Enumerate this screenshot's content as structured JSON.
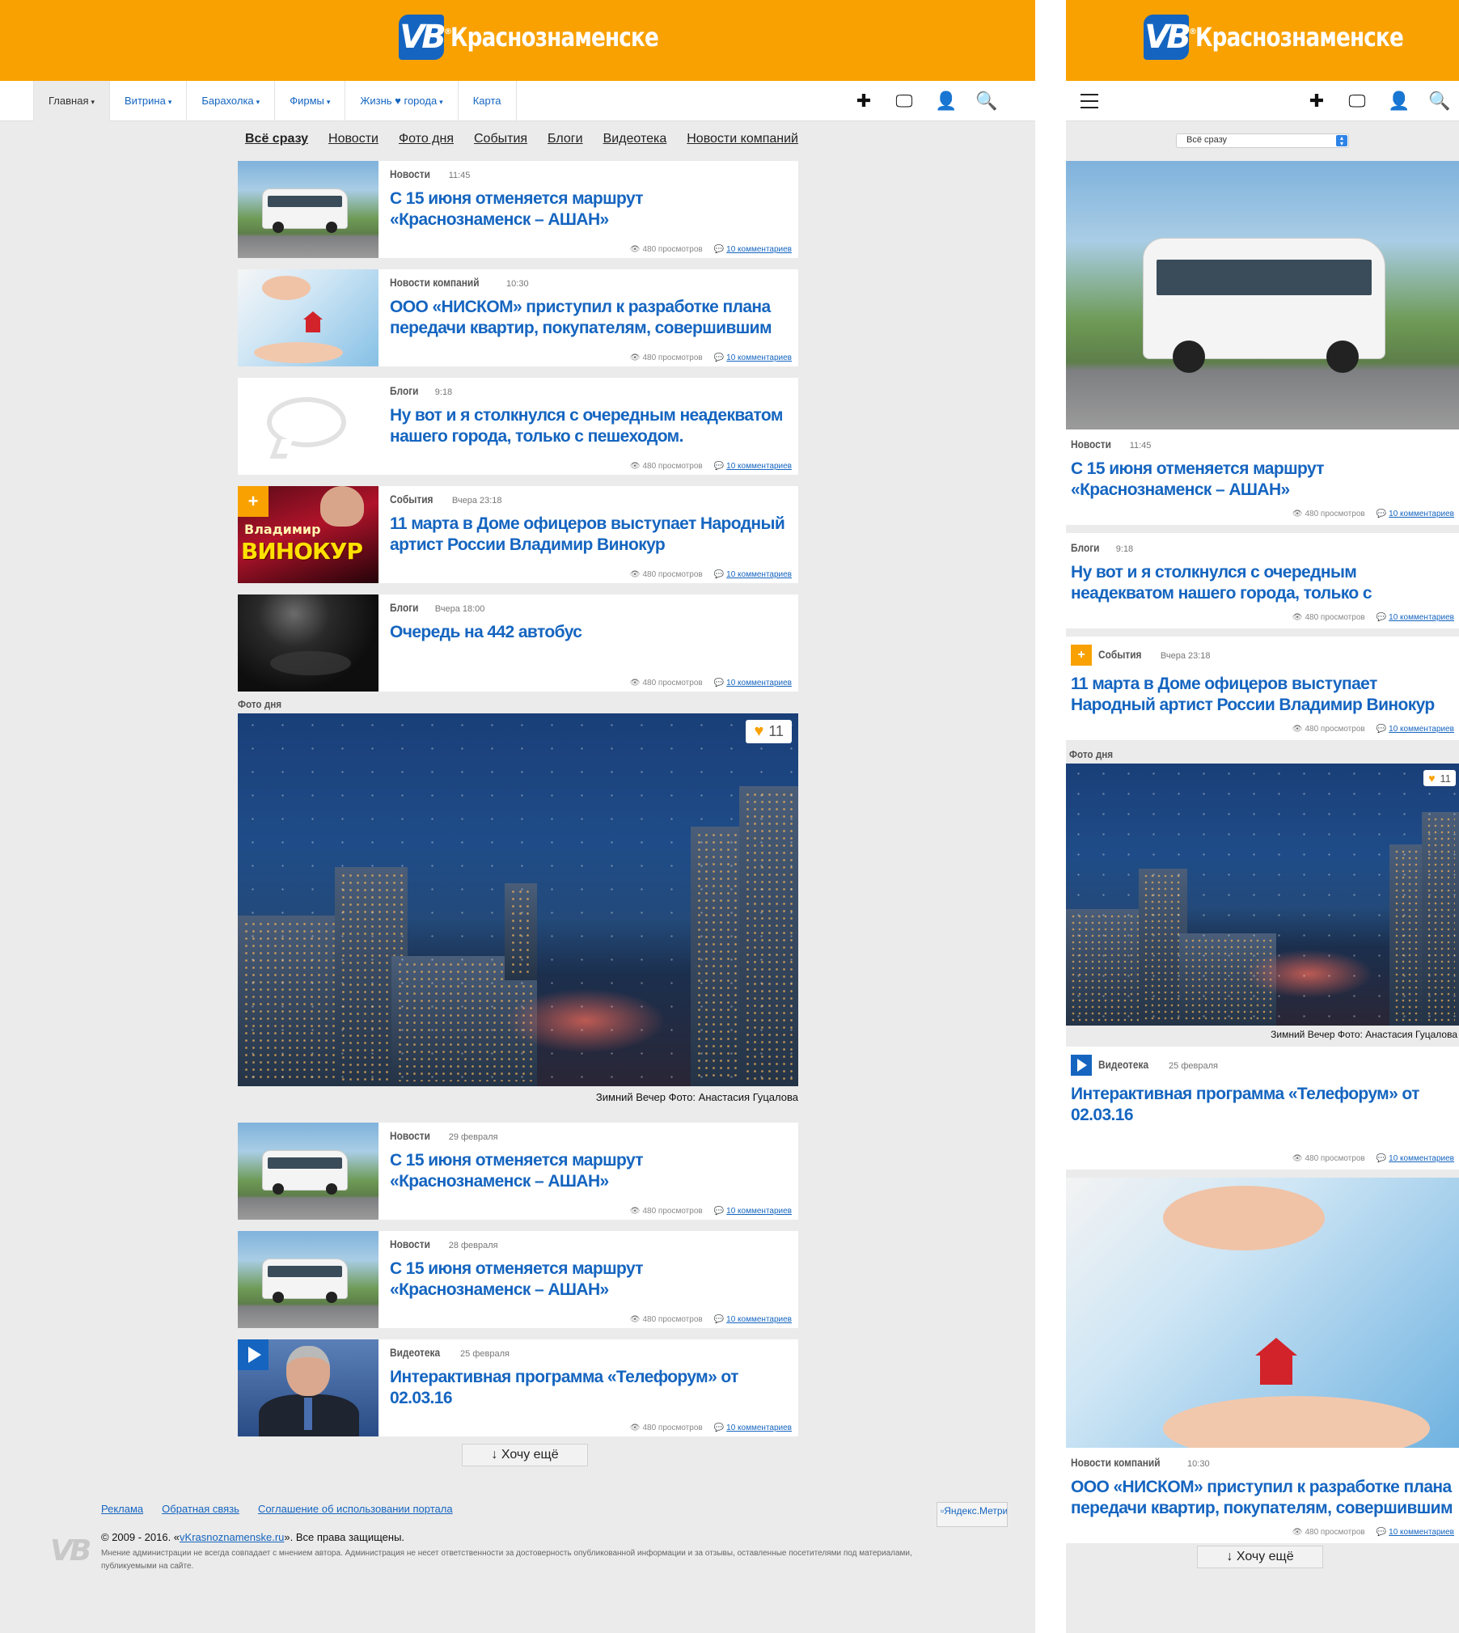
{
  "brand": {
    "logo_letters": "VB",
    "city": "Краснознаменске",
    "color_header": "#f9a100",
    "color_link": "#1565c0"
  },
  "nav": {
    "items": [
      "Главная",
      "Витрина",
      "Барахолка",
      "Фирмы",
      "Жизнь ♥ города",
      "Карта"
    ],
    "caret": "▾",
    "tools": [
      "plus-icon",
      "monitor-icon",
      "user-icon",
      "search-icon"
    ]
  },
  "filters": [
    "Всё сразу",
    "Новости",
    "Фото дня",
    "События",
    "Блоги",
    "Видеотека",
    "Новости компаний"
  ],
  "stats": {
    "views": "480 просмотров",
    "comments": "10 комментариев"
  },
  "feed_top": [
    {
      "category": "Новости",
      "time": "11:45",
      "title": "С 15 июня отменяется маршрут «Краснознаменск – АШАН»",
      "image": "bus"
    },
    {
      "category": "Новости компаний",
      "time": "10:30",
      "title": "ООО «НИСКОМ» приступил к разработке плана передачи квартир, покупателям, совершившим покупку квартир в",
      "image": "keys"
    },
    {
      "category": "Блоги",
      "time": "9:18",
      "title": "Ну вот и я столкнулся с очередным неадекватом нашего города, только с пешеходом.",
      "image": "speech-bubble"
    },
    {
      "category": "События",
      "time": "Вчера 23:18",
      "title": "11 марта в Доме офицеров выступает Народный артист России Владимир Винокур",
      "image": "poster",
      "poster_top": "Владимир",
      "poster_name": "ВИНОКУР"
    },
    {
      "category": "Блоги",
      "time": "Вчера 18:00",
      "title": "Очередь на 442 автобус",
      "image": "night"
    }
  ],
  "photo_of_day": {
    "label": "Фото дня",
    "likes": "11",
    "caption": "Зимний Вечер Фото: Анастасия Гуцалова"
  },
  "feed_bottom": [
    {
      "category": "Новости",
      "time": "29 февраля",
      "title": "С 15 июня отменяется маршрут «Краснознаменск – АШАН»",
      "image": "bus"
    },
    {
      "category": "Новости",
      "time": "28 февраля",
      "title": "С 15 июня отменяется маршрут «Краснознаменск – АШАН»",
      "image": "bus"
    },
    {
      "category": "Видеотека",
      "time": "25 февраля",
      "title": "Интерактивная программа «Телефорум» от 02.03.16",
      "image": "video"
    }
  ],
  "more_button": "↓ Хочу ещё",
  "footer": {
    "links": [
      "Реклама",
      "Обратная связь",
      "Соглашение об использовании портала"
    ],
    "copyright_prefix": "© 2009 - 2016. «",
    "copyright_link": "vKrasnoznamenske.ru",
    "copyright_suffix": "». Все права защищены.",
    "disclaimer": "Мнение администрации не всегда совпадает с мнением автора. Администрация не несет ответственности за достоверность опубликованной информации и за отзывы, оставленные посетителями под материалами, публикуемыми на сайте.",
    "yandex": "Яндекс.Метрика"
  },
  "mobile": {
    "select_value": "Всё сразу",
    "cards": [
      {
        "category": "Новости",
        "time": "11:45",
        "title": "С 15 июня отменяется маршрут «Краснознаменск – АШАН»"
      },
      {
        "category": "Блоги",
        "time": "9:18",
        "title": "Ну вот и я столкнулся с очередным неадекватом нашего города, только с пешеходом."
      },
      {
        "category": "События",
        "time": "Вчера 23:18",
        "title": "11 марта в Доме офицеров выступает Народный артист России Владимир Винокур"
      },
      {
        "category": "Видеотека",
        "time": "25 февраля",
        "title": "Интерактивная программа «Телефорум» от 02.03.16"
      },
      {
        "category": "Новости компаний",
        "time": "10:30",
        "title": "ООО «НИСКОМ» приступил к разработке плана передачи квартир, покупателям, совершившим"
      }
    ]
  }
}
